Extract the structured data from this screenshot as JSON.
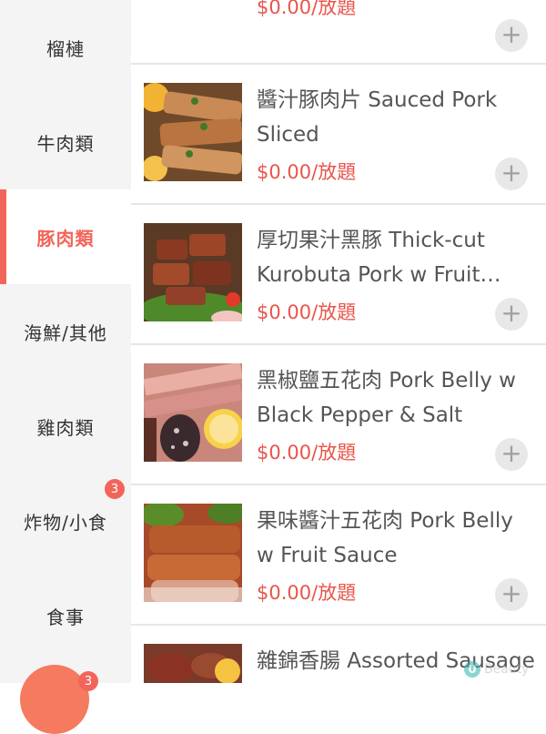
{
  "sidebar": {
    "categories": [
      {
        "label": "榴槤"
      },
      {
        "label": "牛肉類"
      },
      {
        "label": "豚肉類",
        "active": true
      },
      {
        "label": "海鮮/其他"
      },
      {
        "label": "雞肉類"
      },
      {
        "label": "炸物/小食",
        "badge": "3"
      },
      {
        "label": "食事"
      }
    ],
    "fab_badge": "3"
  },
  "items": [
    {
      "name": "",
      "price": "$0.00/放題",
      "add_icon": "+"
    },
    {
      "name": "醬汁豚肉片 Sauced Pork Sliced",
      "price": "$0.00/放題",
      "add_icon": "+"
    },
    {
      "name": "厚切果汁黑豚 Thick-cut Kurobuta Pork w Fruit Sauce",
      "price": "$0.00/放題",
      "add_icon": "+"
    },
    {
      "name": "黑椒鹽五花肉 Pork Belly w Black Pepper & Salt",
      "price": "$0.00/放題",
      "add_icon": "+"
    },
    {
      "name": "果味醬汁五花肉 Pork Belly w Fruit Sauce",
      "price": "$0.00/放題",
      "add_icon": "+"
    },
    {
      "name": "雜錦香腸 Assorted Sausage",
      "price": "",
      "add_icon": "+"
    }
  ],
  "watermark": {
    "logo": "U",
    "text": "Beauty"
  },
  "colors": {
    "accent": "#f2655a",
    "price": "#e8554b",
    "sidebar_bg": "#f4f4f4"
  }
}
